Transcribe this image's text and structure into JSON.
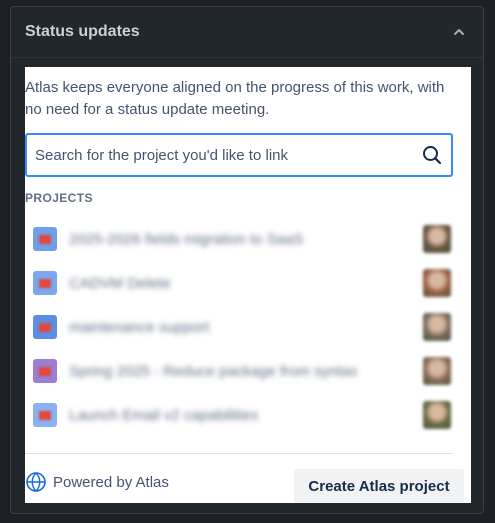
{
  "panel": {
    "title": "Status updates",
    "collapse_icon": "chevron-up-icon"
  },
  "content": {
    "intro": "Atlas keeps everyone aligned on the progress of this work, with no need for a status update meeting.",
    "search": {
      "value": "",
      "placeholder": "Search for the project you'd like to link",
      "icon": "search-icon"
    },
    "projects_heading": "PROJECTS",
    "projects": [
      {
        "name": "2025-2026 fields migration to SaaS",
        "icon_color": "#6f9fe8",
        "avatar_color": "#6b5443"
      },
      {
        "name": "CADVM Delete",
        "icon_color": "#7aa7ef",
        "avatar_color": "#9a5e44"
      },
      {
        "name": "maintenance support",
        "icon_color": "#5b8fe6",
        "avatar_color": "#7d6a5d"
      },
      {
        "name": "Spring 2025 - Reduce package from syntax",
        "icon_color": "#9a7fd3",
        "avatar_color": "#8a6a56"
      },
      {
        "name": "Launch Email v2 capabilities",
        "icon_color": "#8ab1f2",
        "avatar_color": "#6c6b45"
      }
    ]
  },
  "footer": {
    "powered_by": "Powered by Atlas",
    "logo_icon": "atlas-logo-icon",
    "create_button": "Create Atlas project"
  }
}
